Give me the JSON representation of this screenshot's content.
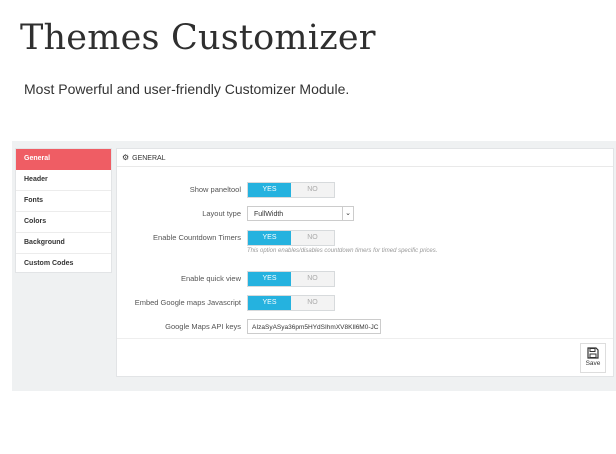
{
  "hero": {
    "title": "Themes Customizer",
    "subtitle": "Most Powerful and user-friendly Customizer Module."
  },
  "sidebar": {
    "items": [
      {
        "label": "General"
      },
      {
        "label": "Header"
      },
      {
        "label": "Fonts"
      },
      {
        "label": "Colors"
      },
      {
        "label": "Background"
      },
      {
        "label": "Custom Codes"
      }
    ]
  },
  "panel": {
    "heading": "GENERAL",
    "heading_icon": "gear-icon",
    "fields": {
      "show_paneltool": {
        "label": "Show paneltool",
        "yes": "YES",
        "no": "NO",
        "selected": "YES"
      },
      "layout_type": {
        "label": "Layout type",
        "value": "FullWidth"
      },
      "countdown": {
        "label": "Enable Countdown Timers",
        "yes": "YES",
        "no": "NO",
        "selected": "YES",
        "hint": "This option enables/disables countdown timers for timed specific prices."
      },
      "quick_view": {
        "label": "Enable quick view",
        "yes": "YES",
        "no": "NO",
        "selected": "YES"
      },
      "google_maps_js": {
        "label": "Embed Google maps Javascript",
        "yes": "YES",
        "no": "NO",
        "selected": "YES"
      },
      "api_keys": {
        "label": "Google Maps API keys",
        "value": "AIzaSyASya36pm5HYdSIhmXV8KIl6M0-JC"
      }
    },
    "save": {
      "label": "Save",
      "icon": "floppy-disk-icon"
    }
  },
  "colors": {
    "active_tab": "#ef5d64",
    "toggle_on": "#25b2df"
  }
}
